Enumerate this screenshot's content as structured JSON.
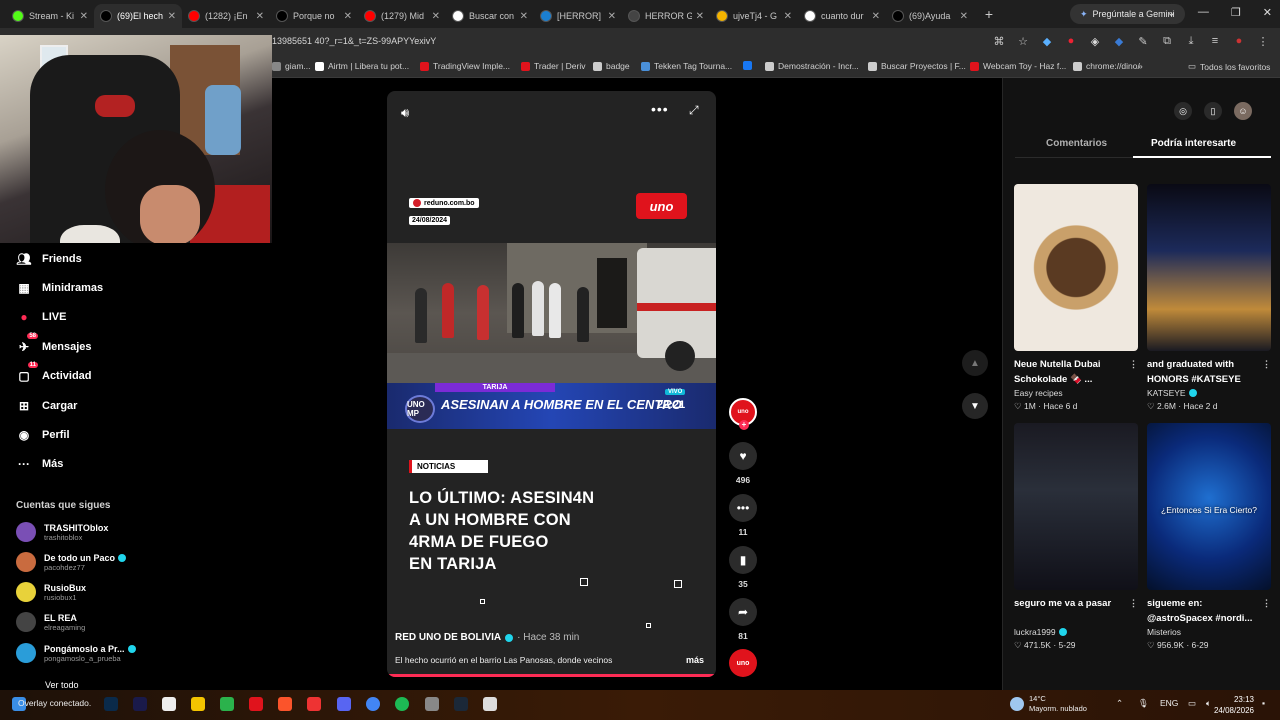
{
  "browser": {
    "tabs": [
      {
        "label": "Stream - Ki",
        "icon": "kick-icon",
        "color": "#53fc18",
        "active": false
      },
      {
        "label": "(69)El hech",
        "icon": "tiktok-icon",
        "color": "#000000",
        "active": true
      },
      {
        "label": "(1282) ¡En",
        "icon": "youtube-icon",
        "color": "#ff0000",
        "active": false
      },
      {
        "label": "Porque no",
        "icon": "tiktok-icon",
        "color": "#000000",
        "active": false
      },
      {
        "label": "(1279) Mid",
        "icon": "youtube-icon",
        "color": "#ff0000",
        "active": false
      },
      {
        "label": "Buscar con",
        "icon": "google-icon",
        "color": "#ffffff",
        "active": false
      },
      {
        "label": "[HERROR] C",
        "icon": "steam-icon",
        "color": "#1b7fd1",
        "active": false
      },
      {
        "label": "HERROR G",
        "icon": "herror-icon",
        "color": "#444444",
        "active": false
      },
      {
        "label": "ujveTj4 - G",
        "icon": "folder-icon",
        "color": "#f4b400",
        "active": false
      },
      {
        "label": "cuanto dur",
        "icon": "google-icon",
        "color": "#ffffff",
        "active": false
      },
      {
        "label": "(69)Ayuda",
        "icon": "tiktok-icon",
        "color": "#000000",
        "active": false
      }
    ],
    "gemini_label": "Pregúntale a Gemini",
    "url": "13985651 40?_r=1&_t=ZS-99APYYexivY",
    "bookmarks": [
      {
        "label": "giam...",
        "color": "#888888"
      },
      {
        "label": "Airtm | Libera tu pot...",
        "color": "#ffffff"
      },
      {
        "label": "TradingView Imple...",
        "color": "#e0131c"
      },
      {
        "label": "Trader | Deriv",
        "color": "#e0131c"
      },
      {
        "label": "badge",
        "color": "#cccccc"
      },
      {
        "label": "Tekken Tag Tourna...",
        "color": "#4a90d9"
      },
      {
        "label": "",
        "color": "#1877f2"
      },
      {
        "label": "Demostración - Incr...",
        "color": "#cccccc"
      },
      {
        "label": "Buscar Proyectos | F...",
        "color": "#cccccc"
      },
      {
        "label": "Webcam Toy - Haz f...",
        "color": "#e0131c"
      },
      {
        "label": "chrome://dino/",
        "color": "#cccccc"
      }
    ],
    "all_bookmarks": "Todos los favoritos"
  },
  "sidebar": {
    "nav": [
      {
        "label": "Friends",
        "icon": "friends-icon",
        "badge": ""
      },
      {
        "label": "Minidramas",
        "icon": "minidramas-icon",
        "badge": ""
      },
      {
        "label": "LIVE",
        "icon": "live-icon",
        "badge": ""
      },
      {
        "label": "Mensajes",
        "icon": "messages-icon",
        "badge": "58"
      },
      {
        "label": "Actividad",
        "icon": "activity-icon",
        "badge": "11"
      },
      {
        "label": "Cargar",
        "icon": "upload-icon",
        "badge": ""
      },
      {
        "label": "Perfil",
        "icon": "profile-icon",
        "badge": ""
      },
      {
        "label": "Más",
        "icon": "more-icon",
        "badge": ""
      }
    ],
    "following_title": "Cuentas que sigues",
    "following": [
      {
        "name": "TRASHITOblox",
        "handle": "trashitoblox",
        "verified": false,
        "color": "#7a4fb5"
      },
      {
        "name": "De todo un Paco",
        "handle": "pacohdez77",
        "verified": true,
        "color": "#c96b3f"
      },
      {
        "name": "RusioBux",
        "handle": "rusiobux1",
        "verified": false,
        "color": "#e8d23a"
      },
      {
        "name": "EL REA",
        "handle": "elreagaming",
        "verified": false,
        "color": "#444444"
      },
      {
        "name": "Pongámoslo a Pr...",
        "handle": "pongamoslo_a_prueba",
        "verified": true,
        "color": "#2a9dd9"
      }
    ],
    "see_all": "Ver todo"
  },
  "video": {
    "source": "reduno.com.bo",
    "date": "24/08/2024",
    "channel_logo": "uno",
    "banner_category": "TARIJA",
    "banner_logo": "UNO MP",
    "banner_headline": "ASESINAN A HOMBRE EN EL CENTRO",
    "banner_live": "VIVO",
    "banner_time": "22:21",
    "tag": "NOTICIAS",
    "headline_lines": [
      "LO ÚLTIMO: ASESIN4N",
      "A UN HOMBRE CON",
      "4RMA DE FUEGO",
      "EN TARIJA"
    ],
    "author": "RED UNO DE BOLIVIA",
    "posted": "· Hace 38 min",
    "description": "El hecho ocurrió en el barrio Las Panosas, donde vecinos",
    "more": "más"
  },
  "actions": {
    "likes": "496",
    "comments": "11",
    "saves": "35",
    "shares": "81",
    "creator_badge": "uno"
  },
  "right_panel": {
    "tab_comments": "Comentarios",
    "tab_suggested": "Podría interesarte",
    "cards": [
      {
        "title": "Neue Nutella Dubai Schokolade 🍫 ...",
        "author": "Easy recipes",
        "verified": false,
        "likes": "1M",
        "ago": "Hace 6 d",
        "overlay": ""
      },
      {
        "title": "and graduated with HONORS #KATSEYE",
        "author": "KATSEYE",
        "verified": true,
        "likes": "2.6M",
        "ago": "Hace 2 d",
        "overlay": ""
      },
      {
        "title": "seguro me va a pasar",
        "author": "luckra1999",
        "verified": true,
        "likes": "471.5K",
        "ago": "5-29",
        "overlay": ""
      },
      {
        "title": "sigueme en: @astroSpacex #nordi...",
        "author": "Misterios",
        "verified": false,
        "likes": "956.9K",
        "ago": "6-29",
        "overlay": "¿Entonces Si Era Cierto?"
      }
    ]
  },
  "taskbar": {
    "overlay_label": "Overlay conectado.",
    "weather_temp": "14°C",
    "weather_desc": "Mayorm. nublado",
    "lang": "ENG",
    "time": "23:13",
    "date": "24/08/2026"
  }
}
